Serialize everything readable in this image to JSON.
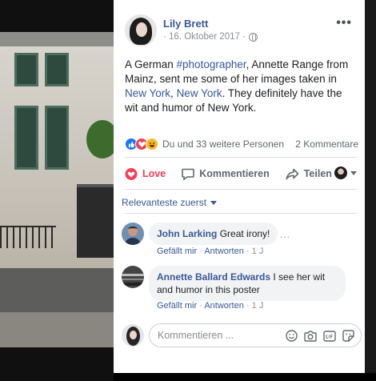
{
  "post": {
    "author": "Lily Brett",
    "date": "· 16. Oktober 2017 ·",
    "more": "•••",
    "text_parts": {
      "t1": "A German ",
      "hashtag": "#photographer",
      "t2": ", Annette Range from Mainz, sent me some of her images taken in ",
      "link1": "New York",
      "t3": ", ",
      "link2": "New York",
      "t4": ". They definitely have the wit and humor of New York."
    },
    "reactions_text": "Du und 33 weitere Personen",
    "comment_count": "2 Kommentare"
  },
  "actions": {
    "love": "Love",
    "comment": "Kommentieren",
    "share": "Teilen"
  },
  "sort_label": "Relevanteste zuerst",
  "comments": [
    {
      "name": "John Larking",
      "text": "Great irony!",
      "like": "Gefällt mir",
      "reply": "Antworten",
      "time": "1 J",
      "more": "..."
    },
    {
      "name": "Annette Ballard Edwards",
      "text": "I see her wit and humor in this poster",
      "like": "Gefällt mir",
      "reply": "Antworten",
      "time": "1 J"
    }
  ],
  "compose": {
    "placeholder": "Kommentieren ..."
  },
  "colors": {
    "link": "#385898",
    "love": "#f33e58",
    "like": "#1877f2",
    "haha": "#f7b928"
  }
}
